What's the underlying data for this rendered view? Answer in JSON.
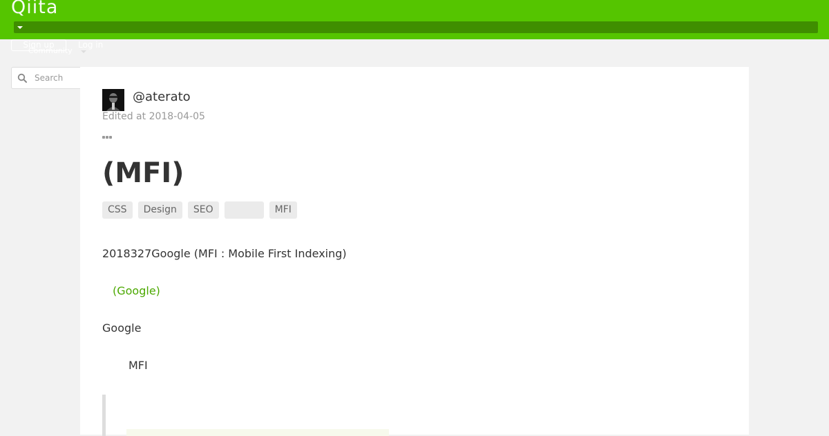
{
  "header": {
    "logo_text": "Qiita",
    "signup_label": "Sign up",
    "login_label": "Log in",
    "community_label": "Community",
    "brand_color": "#55c500"
  },
  "search": {
    "placeholder": "Search"
  },
  "article": {
    "author": "@aterato",
    "edited": "Edited at 2018-04-05",
    "title": "(MFI)",
    "tags": [
      "CSS",
      "Design",
      "SEO",
      "",
      "MFI"
    ],
    "paragraphs": {
      "p1": "2018327Google (MFI : Mobile First Indexing)",
      "link": "(Google)",
      "p3": "Google",
      "p4": "MFI"
    },
    "link_color": "#4ba800"
  }
}
